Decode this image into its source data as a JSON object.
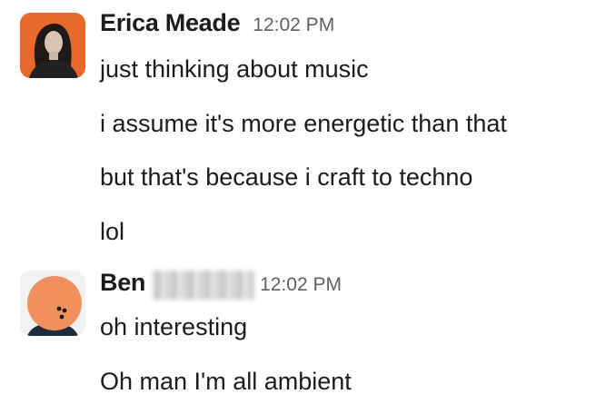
{
  "conversation": {
    "groups": [
      {
        "sender": "Erica Meade",
        "time": "12:02 PM",
        "avatar": "erica-avatar-photo",
        "messages": [
          "just thinking about music",
          "i assume it's more energetic than that",
          "but that's because i craft to techno",
          "lol"
        ]
      },
      {
        "sender": "Ben",
        "surname_redacted": true,
        "time": "12:02 PM",
        "avatar": "ben-avatar-orange-face",
        "messages": [
          "oh interesting",
          "Oh man I'm all ambient"
        ]
      }
    ]
  },
  "colors": {
    "text": "#1d1c1d",
    "timestamp": "#616061",
    "erica_avatar_bg": "#e9692c",
    "ben_avatar_face": "#f0915f"
  }
}
